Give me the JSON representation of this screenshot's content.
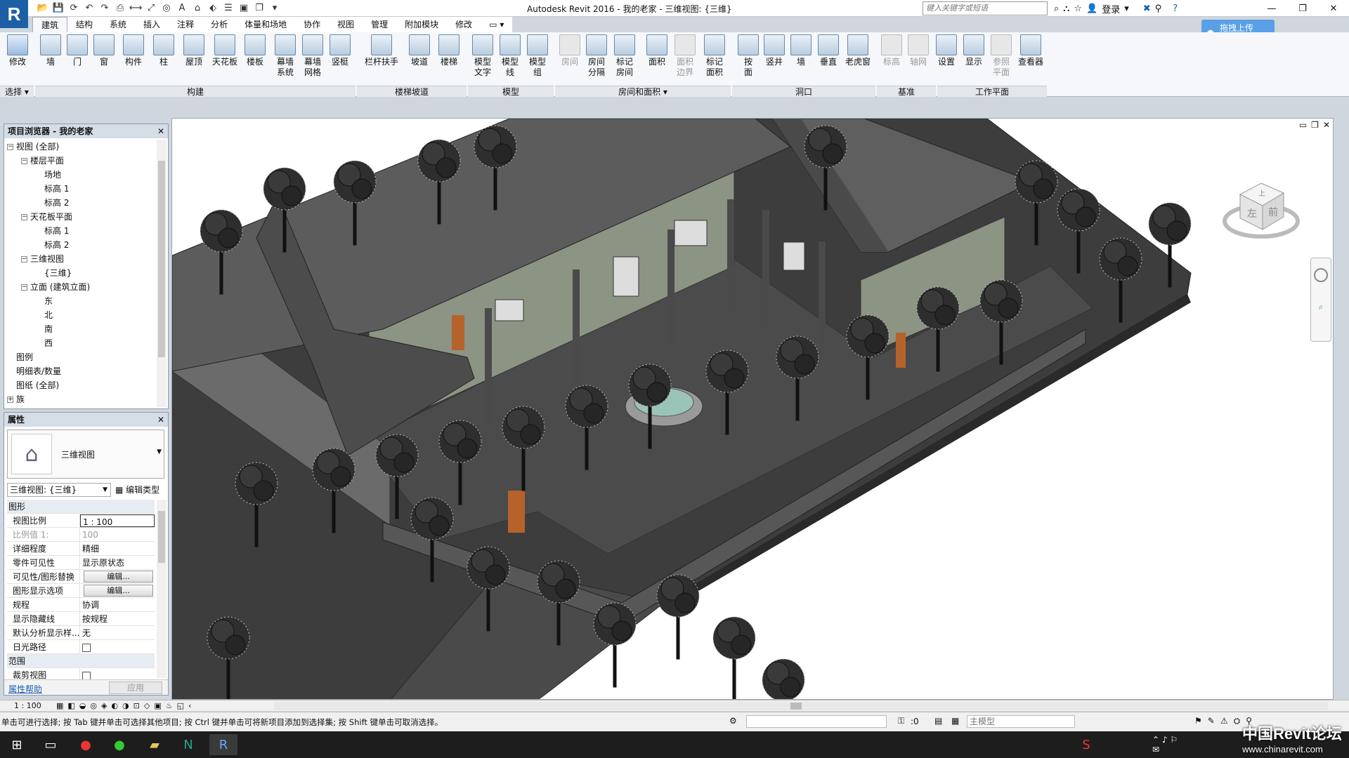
{
  "window": {
    "title": "Autodesk Revit 2016 -     我的老家 - 三维视图: {三维}",
    "search_placeholder": "键入关键字或短语",
    "login": "登录",
    "help": "?"
  },
  "tabs": [
    "建筑",
    "结构",
    "系统",
    "插入",
    "注释",
    "分析",
    "体量和场地",
    "协作",
    "视图",
    "管理",
    "附加模块",
    "修改"
  ],
  "cloud_upload": "拖拽上传",
  "ribbon": {
    "modify": "修改",
    "select_panel": "选择 ▾",
    "build": [
      "墙",
      "门",
      "窗",
      "构件",
      "柱",
      "屋顶",
      "天花板",
      "楼板",
      "幕墙\n系统",
      "幕墙\n网格",
      "竖梃"
    ],
    "stairs": [
      "栏杆扶手",
      "坡道",
      "楼梯"
    ],
    "model": [
      "模型\n文字",
      "模型\n线",
      "模型\n组"
    ],
    "room": [
      "房间",
      "房间\n分隔",
      "标记\n房间",
      "面积",
      "面积\n边界",
      "标记\n面积"
    ],
    "opening": [
      "按\n面",
      "竖井",
      "墙",
      "垂直",
      "老虎窗"
    ],
    "datum": [
      "标高",
      "轴网"
    ],
    "workplane": [
      "设置",
      "显示",
      "参照\n平面",
      "查看器"
    ],
    "panels": [
      "构建",
      "楼梯坡道",
      "模型",
      "房间和面积 ▾",
      "洞口",
      "基准",
      "工作平面"
    ]
  },
  "browser": {
    "title": "项目浏览器 - 我的老家",
    "items": [
      {
        "label": "视图 (全部)",
        "depth": 0,
        "tog": "−"
      },
      {
        "label": "楼层平面",
        "depth": 1,
        "tog": "−"
      },
      {
        "label": "场地",
        "depth": 2,
        "tog": ""
      },
      {
        "label": "标高 1",
        "depth": 2,
        "tog": ""
      },
      {
        "label": "标高 2",
        "depth": 2,
        "tog": ""
      },
      {
        "label": "天花板平面",
        "depth": 1,
        "tog": "−"
      },
      {
        "label": "标高 1",
        "depth": 2,
        "tog": ""
      },
      {
        "label": "标高 2",
        "depth": 2,
        "tog": ""
      },
      {
        "label": "三维视图",
        "depth": 1,
        "tog": "−"
      },
      {
        "label": "{三维}",
        "depth": 2,
        "tog": ""
      },
      {
        "label": "立面 (建筑立面)",
        "depth": 1,
        "tog": "−"
      },
      {
        "label": "东",
        "depth": 2,
        "tog": ""
      },
      {
        "label": "北",
        "depth": 2,
        "tog": ""
      },
      {
        "label": "南",
        "depth": 2,
        "tog": ""
      },
      {
        "label": "西",
        "depth": 2,
        "tog": ""
      },
      {
        "label": "图例",
        "depth": 0,
        "tog": ""
      },
      {
        "label": "明细表/数量",
        "depth": 0,
        "tog": ""
      },
      {
        "label": "图纸 (全部)",
        "depth": 0,
        "tog": ""
      },
      {
        "label": "族",
        "depth": 0,
        "tog": "+"
      }
    ]
  },
  "props": {
    "title": "属性",
    "type_name": "三维视图",
    "instance": "三维视图: {三维}",
    "edit_type": "编辑类型",
    "rows": [
      {
        "k": "图形",
        "v": "",
        "kind": "grp"
      },
      {
        "k": "视图比例",
        "v": "1 : 100",
        "kind": "edit"
      },
      {
        "k": "比例值 1:",
        "v": "100",
        "kind": "dim"
      },
      {
        "k": "详细程度",
        "v": "精细",
        "kind": ""
      },
      {
        "k": "零件可见性",
        "v": "显示原状态",
        "kind": ""
      },
      {
        "k": "可见性/图形替换",
        "v": "编辑...",
        "kind": "btn"
      },
      {
        "k": "图形显示选项",
        "v": "编辑...",
        "kind": "btn"
      },
      {
        "k": "规程",
        "v": "协调",
        "kind": ""
      },
      {
        "k": "显示隐藏线",
        "v": "按规程",
        "kind": ""
      },
      {
        "k": "默认分析显示样...",
        "v": "无",
        "kind": ""
      },
      {
        "k": "日光路径",
        "v": "",
        "kind": "chk"
      },
      {
        "k": "范围",
        "v": "",
        "kind": "grp"
      },
      {
        "k": "裁剪视图",
        "v": "",
        "kind": "chk"
      }
    ],
    "help": "属性帮助",
    "apply": "应用"
  },
  "viewcube": {
    "top": "上",
    "front": "前",
    "left": "左"
  },
  "viewbar": {
    "scale": "1 : 100"
  },
  "status": {
    "message": "单击可进行选择; 按 Tab 键并单击可选择其他项目; 按 Ctrl 键并单击可将新项目添加到选择集; 按 Shift 键单击可取消选择。",
    "zero": ":0",
    "model": "主模型"
  },
  "watermark": {
    "main": "中国Revit论坛",
    "sub": "www.chinarevit.com"
  },
  "colors": {
    "ground": "#3d3d3d",
    "roof": "#5c5c5c",
    "wall": "#8c9484",
    "door": "#b5632b",
    "water": "#9bc4b8"
  }
}
